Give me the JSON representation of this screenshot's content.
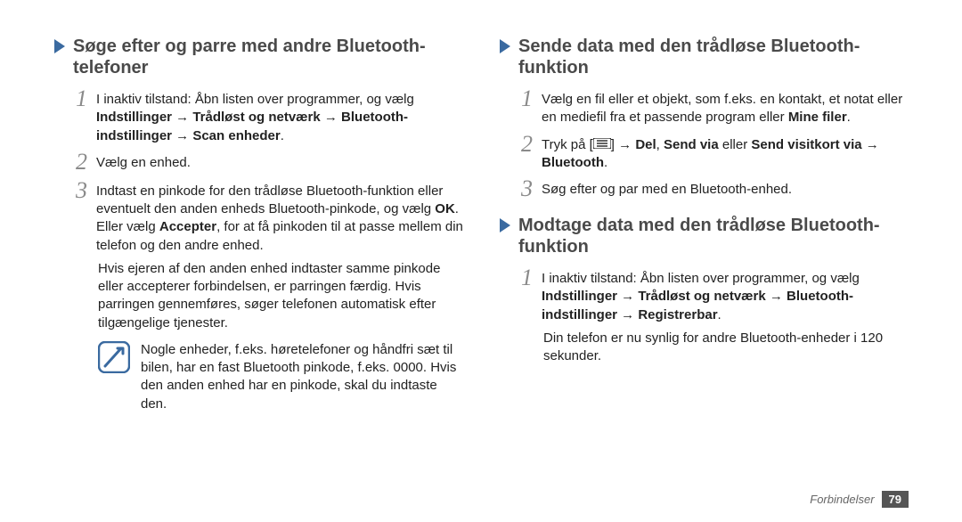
{
  "left": {
    "heading": "Søge efter og parre med andre Bluetooth-telefoner",
    "step1_a": "I inaktiv tilstand: Åbn listen over programmer, og vælg ",
    "step1_b": "Indstillinger → Trådløst og netværk → Bluetooth-indstillinger → Scan enheder",
    "step1_c": ".",
    "step2": "Vælg en enhed.",
    "step3_a": "Indtast en pinkode for den trådløse Bluetooth-funktion eller eventuelt den anden enheds Bluetooth-pinkode, og vælg ",
    "step3_b": "OK",
    "step3_c": ". Eller vælg ",
    "step3_d": "Accepter",
    "step3_e": ", for at få pinkoden til at passe mellem din telefon og den andre enhed.",
    "para": "Hvis ejeren af den anden enhed indtaster samme pinkode eller accepterer forbindelsen, er parringen færdig. Hvis parringen gennemføres, søger telefonen automatisk efter tilgængelige tjenester.",
    "note": "Nogle enheder, f.eks. høretelefoner og håndfri sæt til bilen, har en fast Bluetooth pinkode, f.eks. 0000. Hvis den anden enhed har en pinkode, skal du indtaste den."
  },
  "right": {
    "heading1": "Sende data med den trådløse Bluetooth-funktion",
    "r1_step1_a": "Vælg en fil eller et objekt, som f.eks. en kontakt, et notat eller en mediefil fra et passende program eller ",
    "r1_step1_b": "Mine filer",
    "r1_step1_c": ".",
    "r1_step2_a": "Tryk på [",
    "r1_step2_b": "] → ",
    "r1_step2_c": "Del",
    "r1_step2_d": ", ",
    "r1_step2_e": "Send via",
    "r1_step2_f": " eller ",
    "r1_step2_g": "Send visitkort via",
    "r1_step2_h": " → ",
    "r1_step2_i": "Bluetooth",
    "r1_step2_j": ".",
    "r1_step3": "Søg efter og par med en Bluetooth-enhed.",
    "heading2": "Modtage data med den trådløse Bluetooth-funktion",
    "r2_step1_a": "I inaktiv tilstand: Åbn listen over programmer, og vælg ",
    "r2_step1_b": "Indstillinger → Trådløst og netværk → Bluetooth-indstillinger → Registrerbar",
    "r2_step1_c": ".",
    "r2_para": "Din telefon er nu synlig for andre Bluetooth-enheder i 120 sekunder."
  },
  "footer": {
    "label": "Forbindelser",
    "page": "79"
  }
}
